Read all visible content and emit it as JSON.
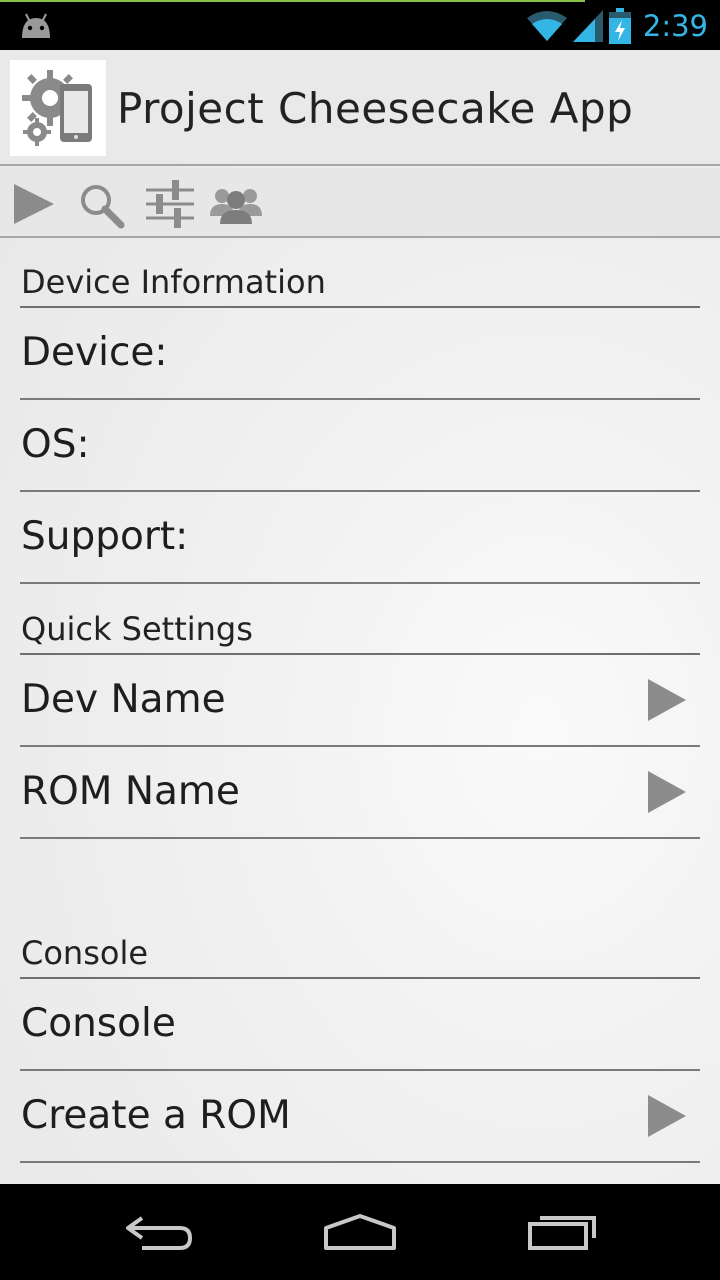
{
  "status_bar": {
    "time": "2:39",
    "icons": [
      "android-notification-icon",
      "wifi-icon",
      "signal-icon",
      "battery-charging-icon"
    ],
    "accent_color": "#33b5e5"
  },
  "app": {
    "title": "Project Cheesecake App",
    "logo_icon": "gear-phone-logo"
  },
  "toolbar": {
    "buttons": [
      {
        "name": "play-icon"
      },
      {
        "name": "search-icon"
      },
      {
        "name": "settings-sliders-icon"
      },
      {
        "name": "people-icon"
      }
    ]
  },
  "sections": {
    "device_information": {
      "title": "Device Information",
      "items": [
        {
          "label": "Device:"
        },
        {
          "label": "OS:"
        },
        {
          "label": "Support:"
        }
      ]
    },
    "quick_settings": {
      "title": "Quick Settings",
      "items": [
        {
          "label": "Dev Name",
          "has_arrow": true
        },
        {
          "label": "ROM Name",
          "has_arrow": true
        }
      ]
    },
    "console": {
      "title": "Console",
      "items": [
        {
          "label": "Console",
          "has_arrow": false
        },
        {
          "label": "Create a ROM",
          "has_arrow": true
        }
      ]
    }
  },
  "nav_bar": {
    "buttons": [
      "back-icon",
      "home-icon",
      "recent-apps-icon"
    ]
  }
}
